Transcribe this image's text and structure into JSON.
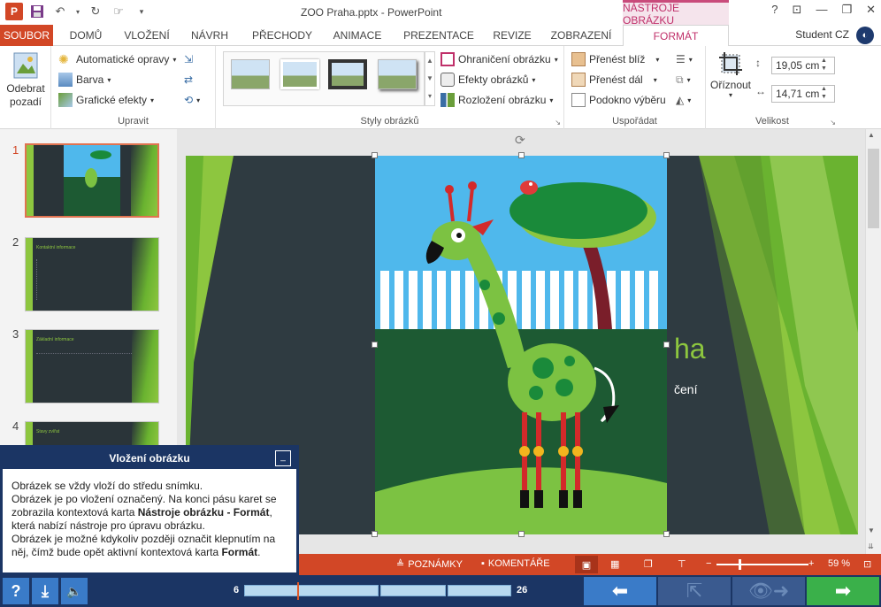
{
  "app": {
    "title": "ZOO Praha.pptx - PowerPoint",
    "context_group": "NÁSTROJE OBRÁZKU",
    "user": "Student CZ"
  },
  "tabs": [
    "SOUBOR",
    "DOMŮ",
    "VLOŽENÍ",
    "NÁVRH",
    "PŘECHODY",
    "ANIMACE",
    "PREZENTACE",
    "REVIZE",
    "ZOBRAZENÍ",
    "FORMÁT"
  ],
  "ribbon": {
    "remove_bg": "Odebrat pozadí",
    "adjust": {
      "auto_fix": "Automatické opravy",
      "color": "Barva",
      "artistic": "Grafické efekty",
      "label": "Upravit"
    },
    "styles": {
      "border": "Ohraničení obrázku",
      "effects": "Efekty obrázků",
      "layout": "Rozložení obrázku",
      "label": "Styly obrázků"
    },
    "arrange": {
      "bring_forward": "Přenést blíž",
      "send_backward": "Přenést dál",
      "selection_pane": "Podokno výběru",
      "label": "Uspořádat"
    },
    "size": {
      "crop": "Oříznout",
      "height": "19,05 cm",
      "width": "14,71 cm",
      "label": "Velikost"
    }
  },
  "thumbnails": [
    {
      "num": "1",
      "title": ""
    },
    {
      "num": "2",
      "title": "Kontaktní informace"
    },
    {
      "num": "3",
      "title": "Základní informace"
    },
    {
      "num": "4",
      "title": "Stavy zvířat"
    }
  ],
  "slide": {
    "partial_title": "ha",
    "partial_subtitle": "čení"
  },
  "statusbar": {
    "notes": "POZNÁMKY",
    "comments": "KOMENTÁŘE",
    "zoom": "59 %"
  },
  "help": {
    "title": "Vložení obrázku",
    "lines": [
      "Obrázek se vždy vloží do středu snímku.",
      "Obrázek je po vložení označený. Na konci pásu karet se zobrazila kontextová karta ",
      "Nástroje obrázku - Formát",
      ", která nabízí nástroje pro úpravu obrázku.",
      "Obrázek je možné kdykoliv později označit klepnutím na něj, čímž bude opět aktivní kontextová karta ",
      "Formát",
      "."
    ],
    "minimize": "_"
  },
  "nav": {
    "help": "?",
    "progress_start": "6",
    "progress_end": "26"
  }
}
